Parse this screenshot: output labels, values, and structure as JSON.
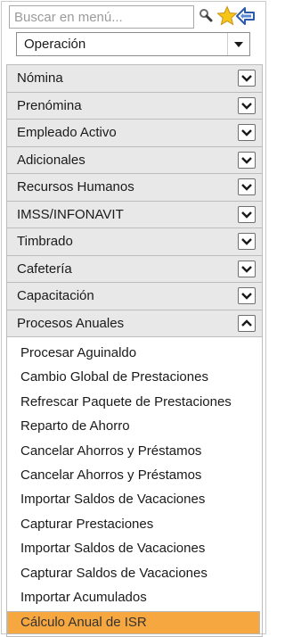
{
  "search": {
    "placeholder": "Buscar en menú..."
  },
  "toolbar": {
    "icons": [
      "search-icon",
      "favorites-star-icon",
      "back-icon"
    ]
  },
  "module_select": {
    "value": "Operación"
  },
  "menu": {
    "categories": [
      {
        "label": "Nómina",
        "expanded": false
      },
      {
        "label": "Prenómina",
        "expanded": false
      },
      {
        "label": "Empleado Activo",
        "expanded": false
      },
      {
        "label": "Adicionales",
        "expanded": false
      },
      {
        "label": "Recursos Humanos",
        "expanded": false
      },
      {
        "label": "IMSS/INFONAVIT",
        "expanded": false
      },
      {
        "label": "Timbrado",
        "expanded": false
      },
      {
        "label": "Cafetería",
        "expanded": false
      },
      {
        "label": "Capacitación",
        "expanded": false
      },
      {
        "label": "Procesos Anuales",
        "expanded": true
      }
    ],
    "items": [
      "Procesar Aguinaldo",
      "Cambio Global de Prestaciones",
      "Refrescar Paquete de Prestaciones",
      "Reparto de Ahorro",
      "Cancelar Ahorros y Préstamos",
      "Cancelar Ahorros y Préstamos",
      "Importar Saldos de Vacaciones",
      "Capturar Prestaciones",
      "Importar Saldos de Vacaciones",
      "Capturar Saldos de Vacaciones",
      "Importar Acumulados",
      "Cálculo Anual de ISR"
    ],
    "active_item": "Cálculo Anual de ISR"
  },
  "colors": {
    "accent": "#f7a740",
    "header_bg": "#e8e8e8",
    "star": "#f5c518",
    "back_arrow": "#2a5aa8"
  }
}
